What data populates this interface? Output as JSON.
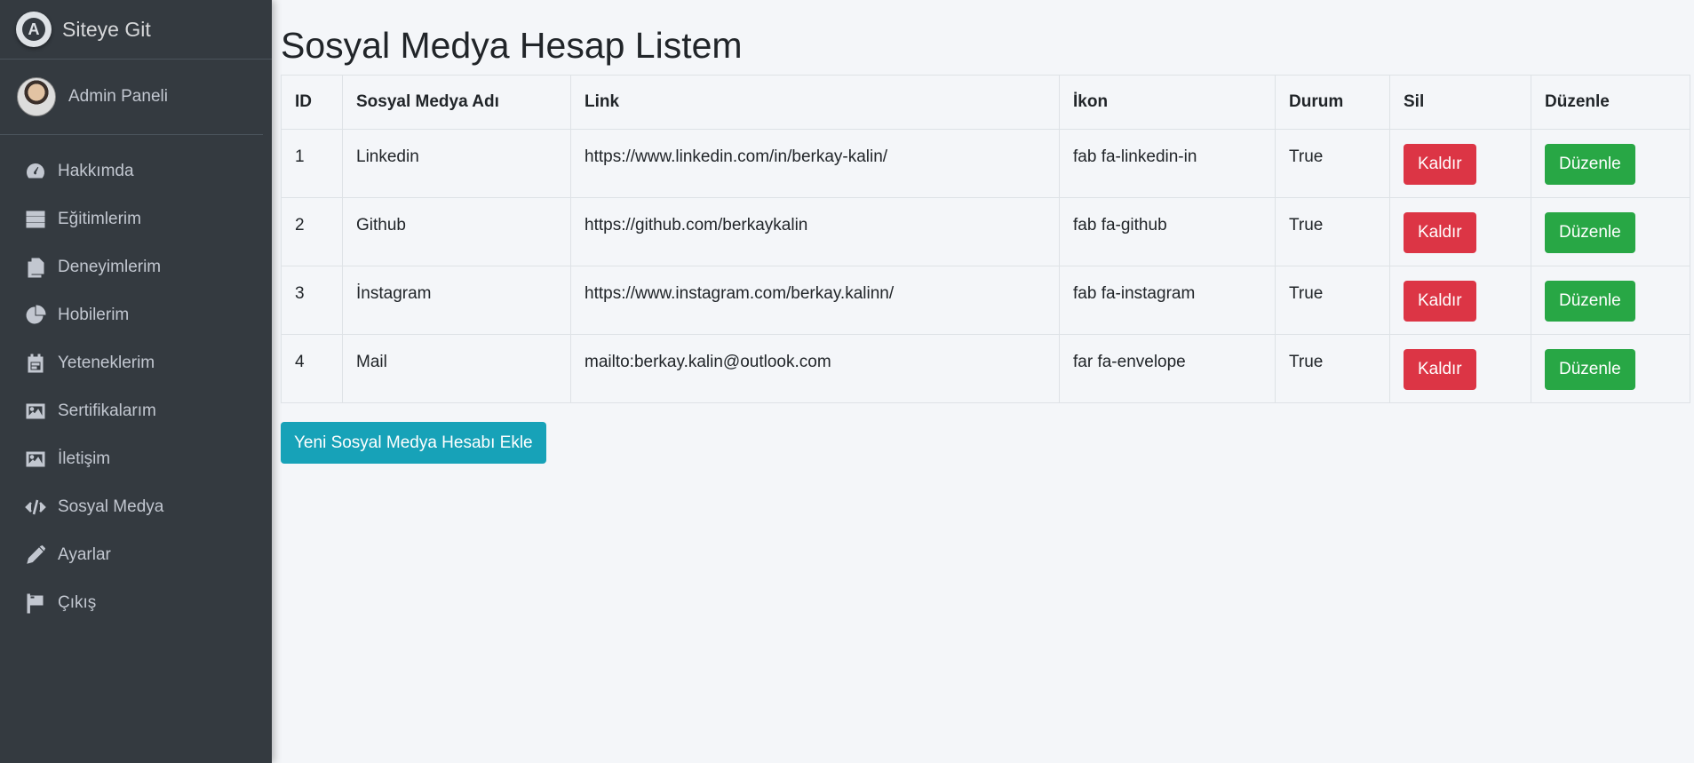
{
  "brand": {
    "title": "Siteye Git"
  },
  "user": {
    "name": "Admin Paneli"
  },
  "sidebar": {
    "items": [
      {
        "label": "Hakkımda",
        "icon": "tachometer-icon"
      },
      {
        "label": "Eğitimlerim",
        "icon": "grid-icon"
      },
      {
        "label": "Deneyimlerim",
        "icon": "copy-icon"
      },
      {
        "label": "Hobilerim",
        "icon": "pie-chart-icon"
      },
      {
        "label": "Yeteneklerim",
        "icon": "calendar-icon"
      },
      {
        "label": "Sertifikalarım",
        "icon": "image-icon"
      },
      {
        "label": "İletişim",
        "icon": "image-icon"
      },
      {
        "label": "Sosyal Medya",
        "icon": "code-icon"
      },
      {
        "label": "Ayarlar",
        "icon": "pencil-icon"
      },
      {
        "label": "Çıkış",
        "icon": "flag-icon"
      }
    ]
  },
  "page": {
    "title": "Sosyal Medya Hesap Listem"
  },
  "table": {
    "headers": [
      "ID",
      "Sosyal Medya Adı",
      "Link",
      "İkon",
      "Durum",
      "Sil",
      "Düzenle"
    ],
    "rows": [
      {
        "id": "1",
        "name": "Linkedin",
        "link": "https://www.linkedin.com/in/berkay-kalin/",
        "icon": "fab fa-linkedin-in",
        "status": "True",
        "delete_label": "Kaldır",
        "edit_label": "Düzenle"
      },
      {
        "id": "2",
        "name": "Github",
        "link": "https://github.com/berkaykalin",
        "icon": "fab fa-github",
        "status": "True",
        "delete_label": "Kaldır",
        "edit_label": "Düzenle"
      },
      {
        "id": "3",
        "name": "İnstagram",
        "link": "https://www.instagram.com/berkay.kalinn/",
        "icon": "fab fa-instagram",
        "status": "True",
        "delete_label": "Kaldır",
        "edit_label": "Düzenle"
      },
      {
        "id": "4",
        "name": "Mail",
        "link": "mailto:berkay.kalin@outlook.com",
        "icon": "far fa-envelope",
        "status": "True",
        "delete_label": "Kaldır",
        "edit_label": "Düzenle"
      }
    ]
  },
  "actions": {
    "add_label": "Yeni Sosyal Medya Hesabı Ekle"
  },
  "colors": {
    "sidebar_bg": "#343a40",
    "danger": "#dc3545",
    "success": "#28a745",
    "info": "#17a2b8",
    "page_bg": "#f4f6f9"
  }
}
